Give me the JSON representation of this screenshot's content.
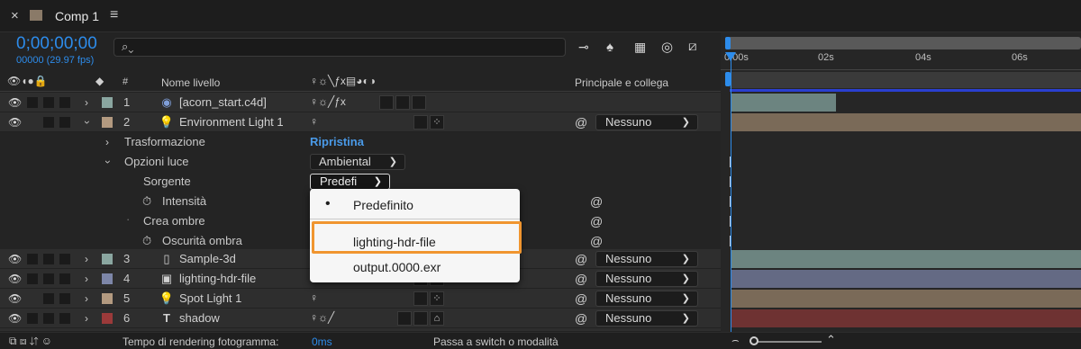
{
  "tab": {
    "close": "×",
    "title": "Comp 1",
    "menu": "≡"
  },
  "time": {
    "timecode": "0;00;00;00",
    "frames": "00000 (29.97 fps)"
  },
  "search": {
    "placeholder": ""
  },
  "headers": {
    "hash": "#",
    "layer_name": "Nome livello",
    "parent": "Principale e collega"
  },
  "switch_icons": [
    "♀",
    "☼",
    "╲",
    "fx"
  ],
  "ruler": [
    "0:00s",
    "02s",
    "04s",
    "06s"
  ],
  "layers": [
    {
      "num": "1",
      "name": "[acorn_start.c4d]",
      "icon": "cinema4d-icon",
      "label_color": "#8aa6a0",
      "expanded": false
    },
    {
      "num": "2",
      "name": "Environment Light 1",
      "icon": "light-icon",
      "label_color": "#b39a80",
      "expanded": true,
      "parent": "Nessuno"
    },
    {
      "num": "3",
      "name": "Sample-3d",
      "icon": "file-icon",
      "label_color": "#8aa6a0",
      "expanded": false,
      "parent": "Nessuno"
    },
    {
      "num": "4",
      "name": "lighting-hdr-file",
      "icon": "file-image-icon",
      "label_color": "#7d86a8",
      "expanded": false,
      "parent": "Nessuno"
    },
    {
      "num": "5",
      "name": "Spot Light 1",
      "icon": "light-icon",
      "label_color": "#b39a80",
      "expanded": false,
      "parent": "Nessuno"
    },
    {
      "num": "6",
      "name": "shadow",
      "icon": "text-icon",
      "label_color": "#9b3a3a",
      "expanded": false,
      "parent": "Nessuno"
    }
  ],
  "props": {
    "transform": "Trasformazione",
    "reset": "Ripristina",
    "light_options": "Opzioni luce",
    "light_type": "Ambiental",
    "source": "Sorgente",
    "source_value": "Predefi",
    "intensity": "Intensità",
    "cast_shadows": "Crea ombre",
    "shadow_darkness": "Oscurità ombra"
  },
  "menu": {
    "bullet": "•",
    "items": [
      "Predefinito",
      "lighting-hdr-file",
      "output.0000.exr"
    ]
  },
  "status": {
    "render_label": "Tempo di rendering fotogramma:",
    "render_value": "0ms",
    "toggle": "Passa a switch o modalità"
  },
  "colors": {
    "accent_blue": "#2d8ceb",
    "highlight_orange": "#f0952f",
    "timeline_blue": "#2a3fd0"
  }
}
